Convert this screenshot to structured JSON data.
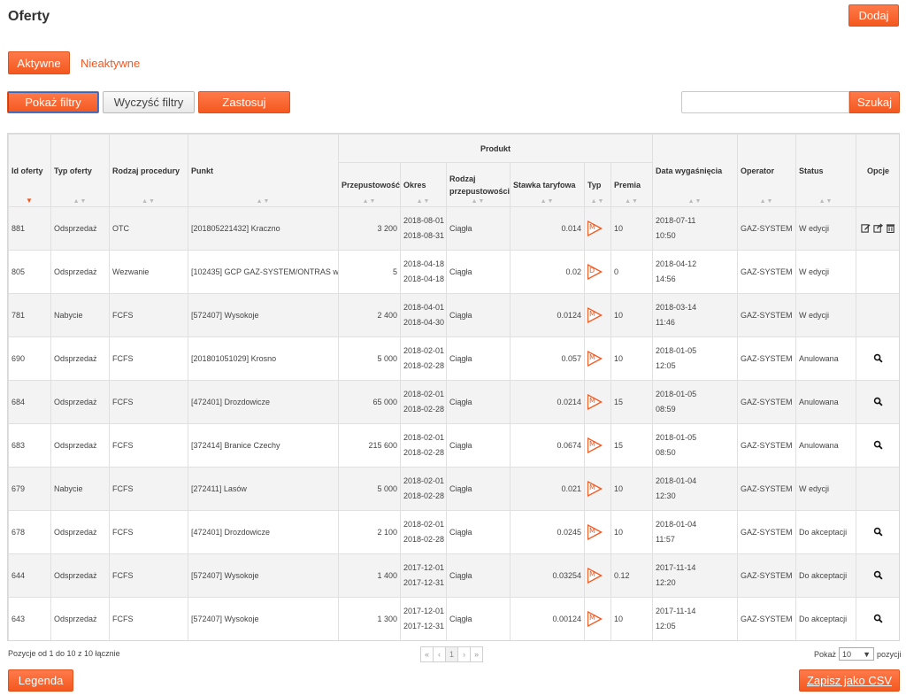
{
  "page": {
    "title": "Oferty"
  },
  "header": {
    "add_label": "Dodaj"
  },
  "tabs": [
    {
      "label": "Aktywne",
      "active": true
    },
    {
      "label": "Nieaktywne",
      "active": false
    }
  ],
  "filters": {
    "show_label": "Pokaż filtry",
    "clear_label": "Wyczyść filtry",
    "apply_label": "Zastosuj"
  },
  "search": {
    "value": "",
    "placeholder": "",
    "button_label": "Szukaj"
  },
  "table": {
    "group_header": "Produkt",
    "columns": {
      "id": "Id oferty",
      "type": "Typ oferty",
      "procedure": "Rodzaj procedury",
      "point": "Punkt",
      "capacity": "Przepustowość",
      "period": "Okres",
      "capacity_kind": "Rodzaj przepustowości",
      "tariff": "Stawka taryfowa",
      "typ": "Typ",
      "premium": "Premia",
      "expiry": "Data wygaśnięcia",
      "operator": "Operator",
      "status": "Status",
      "options": "Opcje"
    },
    "rows": [
      {
        "id": "881",
        "type": "Odsprzedaż",
        "procedure": "OTC",
        "point": "[201805221432] Kraczno",
        "capacity": "3 200",
        "period_from": "2018-08-01",
        "period_to": "2018-08-31",
        "capacity_kind": "Ciągła",
        "tariff": "0.014",
        "typ": "M",
        "premium": "10",
        "expiry_date": "2018-07-11",
        "expiry_time": "10:50",
        "operator": "GAZ-SYSTEM",
        "status": "W edycji",
        "options": [
          "edit-icon",
          "share-icon",
          "trash-icon"
        ]
      },
      {
        "id": "805",
        "type": "Odsprzedaż",
        "procedure": "Wezwanie",
        "point": "[102435] GCP GAZ-SYSTEM/ONTRAS wy",
        "capacity": "5",
        "period_from": "2018-04-18",
        "period_to": "2018-04-18",
        "capacity_kind": "Ciągła",
        "tariff": "0.02",
        "typ": "D",
        "premium": "0",
        "expiry_date": "2018-04-12",
        "expiry_time": "14:56",
        "operator": "GAZ-SYSTEM",
        "status": "W edycji",
        "options": []
      },
      {
        "id": "781",
        "type": "Nabycie",
        "procedure": "FCFS",
        "point": "[572407] Wysokoje",
        "capacity": "2 400",
        "period_from": "2018-04-01",
        "period_to": "2018-04-30",
        "capacity_kind": "Ciągła",
        "tariff": "0.0124",
        "typ": "M",
        "premium": "10",
        "expiry_date": "2018-03-14",
        "expiry_time": "11:46",
        "operator": "GAZ-SYSTEM",
        "status": "W edycji",
        "options": []
      },
      {
        "id": "690",
        "type": "Odsprzedaż",
        "procedure": "FCFS",
        "point": "[201801051029] Krosno",
        "capacity": "5 000",
        "period_from": "2018-02-01",
        "period_to": "2018-02-28",
        "capacity_kind": "Ciągła",
        "tariff": "0.057",
        "typ": "M",
        "premium": "10",
        "expiry_date": "2018-01-05",
        "expiry_time": "12:05",
        "operator": "GAZ-SYSTEM",
        "status": "Anulowana",
        "options": [
          "search-icon"
        ]
      },
      {
        "id": "684",
        "type": "Odsprzedaż",
        "procedure": "FCFS",
        "point": "[472401] Drozdowicze",
        "capacity": "65 000",
        "period_from": "2018-02-01",
        "period_to": "2018-02-28",
        "capacity_kind": "Ciągła",
        "tariff": "0.0214",
        "typ": "M",
        "premium": "15",
        "expiry_date": "2018-01-05",
        "expiry_time": "08:59",
        "operator": "GAZ-SYSTEM",
        "status": "Anulowana",
        "options": [
          "search-icon"
        ]
      },
      {
        "id": "683",
        "type": "Odsprzedaż",
        "procedure": "FCFS",
        "point": "[372414] Branice Czechy",
        "capacity": "215 600",
        "period_from": "2018-02-01",
        "period_to": "2018-02-28",
        "capacity_kind": "Ciągła",
        "tariff": "0.0674",
        "typ": "M",
        "premium": "15",
        "expiry_date": "2018-01-05",
        "expiry_time": "08:50",
        "operator": "GAZ-SYSTEM",
        "status": "Anulowana",
        "options": [
          "search-icon"
        ]
      },
      {
        "id": "679",
        "type": "Nabycie",
        "procedure": "FCFS",
        "point": "[272411] Lasów",
        "capacity": "5 000",
        "period_from": "2018-02-01",
        "period_to": "2018-02-28",
        "capacity_kind": "Ciągła",
        "tariff": "0.021",
        "typ": "M",
        "premium": "10",
        "expiry_date": "2018-01-04",
        "expiry_time": "12:30",
        "operator": "GAZ-SYSTEM",
        "status": "W edycji",
        "options": []
      },
      {
        "id": "678",
        "type": "Odsprzedaż",
        "procedure": "FCFS",
        "point": "[472401] Drozdowicze",
        "capacity": "2 100",
        "period_from": "2018-02-01",
        "period_to": "2018-02-28",
        "capacity_kind": "Ciągła",
        "tariff": "0.0245",
        "typ": "M",
        "premium": "10",
        "expiry_date": "2018-01-04",
        "expiry_time": "11:57",
        "operator": "GAZ-SYSTEM",
        "status": "Do akceptacji",
        "options": [
          "search-icon"
        ]
      },
      {
        "id": "644",
        "type": "Odsprzedaż",
        "procedure": "FCFS",
        "point": "[572407] Wysokoje",
        "capacity": "1 400",
        "period_from": "2017-12-01",
        "period_to": "2017-12-31",
        "capacity_kind": "Ciągła",
        "tariff": "0.03254",
        "typ": "M",
        "premium": "0.12",
        "expiry_date": "2017-11-14",
        "expiry_time": "12:20",
        "operator": "GAZ-SYSTEM",
        "status": "Do akceptacji",
        "options": [
          "search-icon"
        ]
      },
      {
        "id": "643",
        "type": "Odsprzedaż",
        "procedure": "FCFS",
        "point": "[572407] Wysokoje",
        "capacity": "1 300",
        "period_from": "2017-12-01",
        "period_to": "2017-12-31",
        "capacity_kind": "Ciągła",
        "tariff": "0.00124",
        "typ": "M",
        "premium": "10",
        "expiry_date": "2017-11-14",
        "expiry_time": "12:05",
        "operator": "GAZ-SYSTEM",
        "status": "Do akceptacji",
        "options": [
          "search-icon"
        ]
      }
    ]
  },
  "footer": {
    "info": "Pozycje od 1 do 10 z 10 łącznie",
    "pager": {
      "first": "«",
      "prev": "‹",
      "current": "1",
      "next": "›",
      "last": "»"
    },
    "page_size_prefix": "Pokaż",
    "page_size_value": "10",
    "page_size_suffix": "pozycji",
    "legend_label": "Legenda",
    "csv_label": "Zapisz jako CSV"
  },
  "colors": {
    "accent": "#f4581f",
    "header_bg": "#f4f4f4",
    "row_alt": "#f3f3f3"
  }
}
